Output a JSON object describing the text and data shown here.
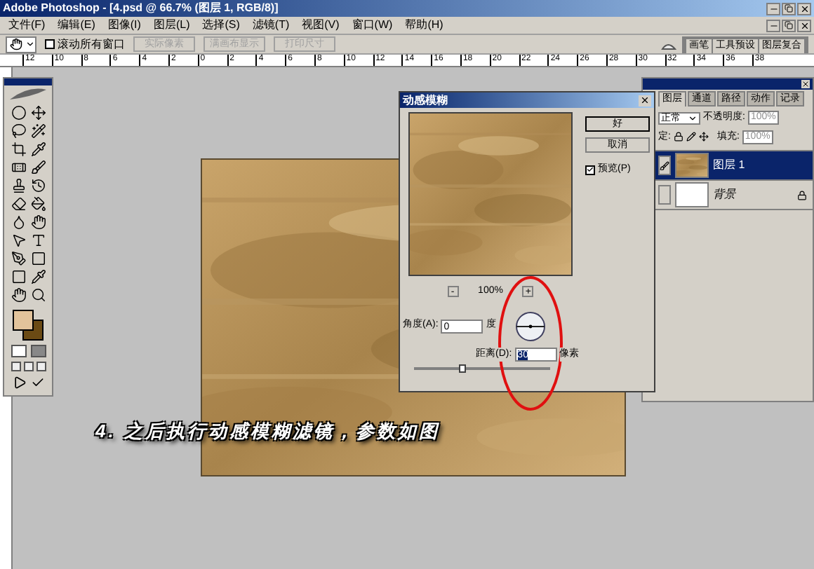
{
  "window": {
    "title": "Adobe Photoshop - [4.psd @ 66.7% (图层 1, RGB/8)]"
  },
  "menu": [
    "文件(F)",
    "编辑(E)",
    "图像(I)",
    "图层(L)",
    "选择(S)",
    "滤镜(T)",
    "视图(V)",
    "窗口(W)",
    "帮助(H)"
  ],
  "options_bar": {
    "scroll_all": {
      "label": "滚动所有窗口",
      "checked": false
    },
    "buttons": [
      {
        "label": "实际像素",
        "disabled": true
      },
      {
        "label": "满画布显示",
        "disabled": true
      },
      {
        "label": "打印尺寸",
        "disabled": true
      }
    ],
    "palette_well": [
      "画笔",
      "工具预设",
      "图层复合"
    ]
  },
  "ruler": [
    "12",
    "10",
    "8",
    "6",
    "4",
    "2",
    "0",
    "2",
    "4",
    "6",
    "8",
    "10",
    "12",
    "14",
    "16",
    "18",
    "20",
    "22",
    "24",
    "26",
    "28",
    "30",
    "32",
    "34",
    "36",
    "38"
  ],
  "dialog": {
    "title": "动感模糊",
    "ok": "好",
    "cancel": "取消",
    "preview": {
      "label": "预览(P)",
      "checked": true
    },
    "zoom_out": "-",
    "zoom": "100%",
    "zoom_in": "+",
    "angle": {
      "label": "角度(A):",
      "value": "0",
      "unit": "度"
    },
    "distance": {
      "label": "距离(D):",
      "value": "30",
      "unit": "像素",
      "level": 0.35
    }
  },
  "layers_palette": {
    "tabs": [
      {
        "label": "图层",
        "selected": true
      },
      {
        "label": "通道",
        "selected": false
      },
      {
        "label": "路径",
        "selected": false
      },
      {
        "label": "动作",
        "selected": false
      },
      {
        "label": "记录",
        "selected": false
      }
    ],
    "blend_mode": "正常",
    "opacity_label": "不透明度:",
    "opacity": "100%",
    "lock_label": "定:",
    "fill_label": "填充:",
    "fill": "100%",
    "layers": [
      {
        "name": "图层 1",
        "selected": true,
        "locked": false,
        "kind": "texture"
      },
      {
        "name": "背景",
        "selected": false,
        "locked": true,
        "kind": "white"
      }
    ]
  },
  "caption": "4. 之后执行动感模糊滤镜，参数如图"
}
